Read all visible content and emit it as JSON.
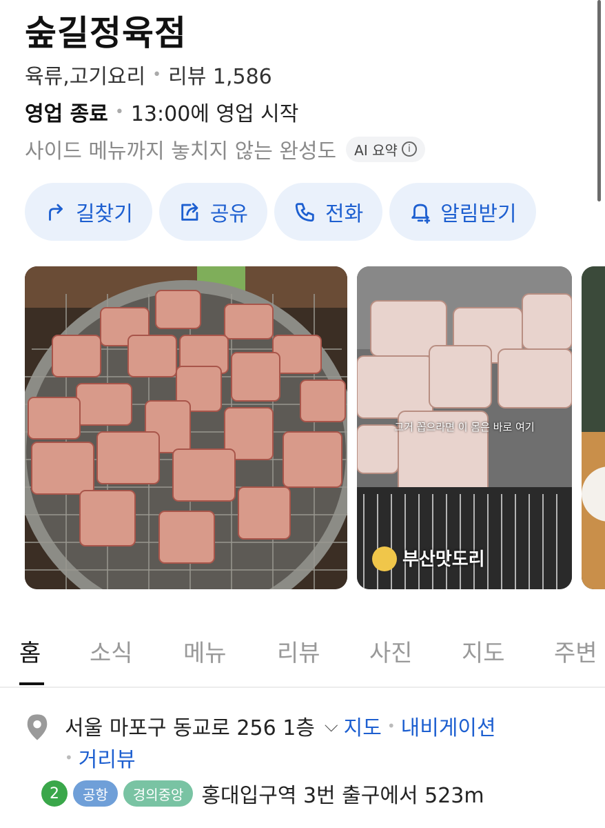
{
  "place": {
    "name": "숲길정육점",
    "category": "육류,고기요리",
    "reviews": "리뷰 1,586",
    "status": "영업 종료",
    "next_open": "13:00에 영업 시작",
    "summary": "사이드 메뉴까지 놓치지 않는 완성도",
    "ai_badge": "AI 요약",
    "ai_info_icon": "i"
  },
  "actions": [
    {
      "label": "길찾기",
      "icon": "directions-arrow-icon"
    },
    {
      "label": "공유",
      "icon": "share-icon"
    },
    {
      "label": "전화",
      "icon": "phone-icon"
    },
    {
      "label": "알림받기",
      "icon": "bell-icon"
    }
  ],
  "photos": {
    "caption": "그거 꼽으라면 이 몸은 바로 여기",
    "channel": "부산맛도리",
    "channel_badge": "부산\n맛도리"
  },
  "tabs": [
    "홈",
    "소식",
    "메뉴",
    "리뷰",
    "사진",
    "지도",
    "주변"
  ],
  "active_tab": "홈",
  "address": {
    "text": "서울 마포구 동교로 256 1층",
    "map_link": "지도",
    "nav_link": "내비게이션",
    "street_view": "거리뷰"
  },
  "transit": {
    "line_number": "2",
    "airport": "공항",
    "gyeongui": "경의중앙",
    "directions": "홍대입구역 3번 출구에서 523m"
  },
  "colors": {
    "accent": "#1d5fd0",
    "button_bg": "#eaf1fb",
    "line2": "#3aa74a",
    "airport": "#6f9fd8",
    "gyeongui": "#79c3a3"
  }
}
